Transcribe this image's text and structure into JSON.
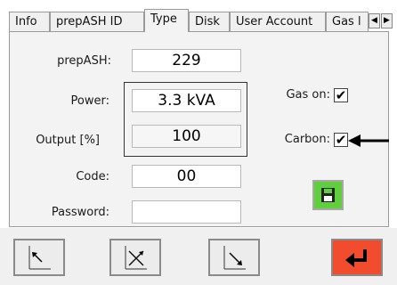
{
  "tabs": [
    {
      "label": "Info",
      "active": false
    },
    {
      "label": "prepASH ID",
      "active": false
    },
    {
      "label": "Type",
      "active": true
    },
    {
      "label": "Disk",
      "active": false
    },
    {
      "label": "User Account",
      "active": false
    },
    {
      "label": "Gas l",
      "active": false
    }
  ],
  "form": {
    "prepash_label": "prepASH:",
    "prepash_value": "229",
    "power_label": "Power:",
    "power_value": "3.3 kVA",
    "output_label": "Output [%]",
    "output_value": "100",
    "code_label": "Code:",
    "code_value": "00",
    "password_label": "Password:",
    "password_value": ""
  },
  "options": {
    "gas_on_label": "Gas on:",
    "gas_on_checked": true,
    "carbon_label": "Carbon:",
    "carbon_checked": true,
    "check_glyph": "✔"
  },
  "icons": {
    "tab_left": "◀",
    "tab_right": "▶",
    "save": "floppy-disk-icon",
    "annotation": "arrow-left-icon"
  },
  "toolbar": {
    "buttons": [
      "arrow-up-left-icon",
      "arrows-cross-icon",
      "arrow-down-right-icon",
      "enter-return-icon"
    ]
  },
  "colors": {
    "save_button": "#5fd03b",
    "enter_button": "#f24c2e"
  }
}
